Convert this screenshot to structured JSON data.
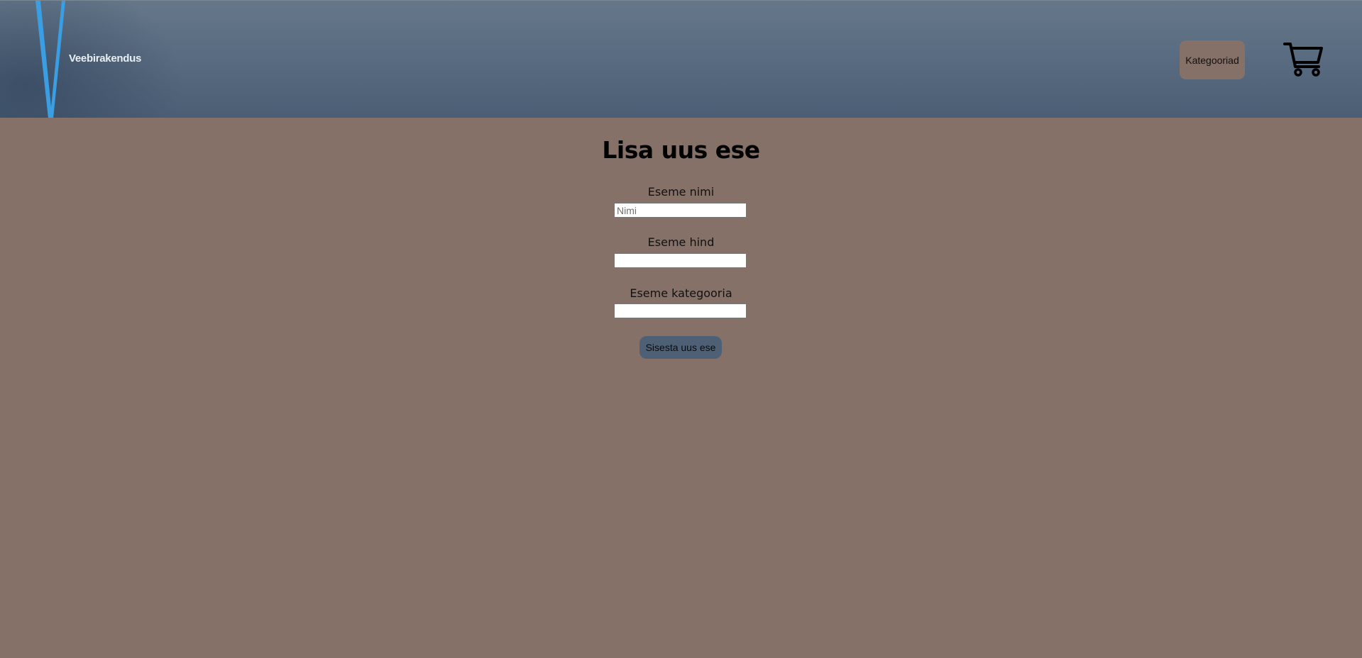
{
  "header": {
    "logo_text": "Veebirakendus",
    "nav_categories_label": "Kategooriad",
    "cart_icon": "shopping-cart-icon",
    "logo_accent_color": "#3a9ee3"
  },
  "form": {
    "title": "Lisa uus ese",
    "fields": [
      {
        "label": "Eseme nimi",
        "placeholder": "Nimi",
        "value": ""
      },
      {
        "label": "Eseme hind",
        "placeholder": "",
        "value": ""
      },
      {
        "label": "Eseme kategooria",
        "placeholder": "",
        "value": ""
      }
    ],
    "submit_label": "Sisesta uus ese"
  },
  "colors": {
    "page_background": "#857167",
    "header_background": "#596b80",
    "submit_button": "#4d6076"
  }
}
